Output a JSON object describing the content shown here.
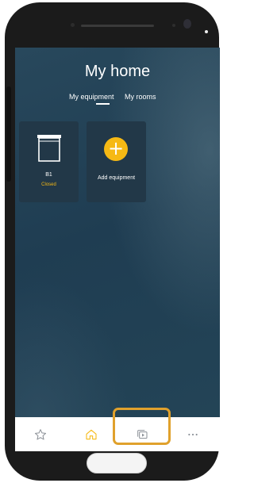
{
  "header": {
    "title": "My home"
  },
  "tabs": [
    {
      "label": "My equipment",
      "active": true
    },
    {
      "label": "My rooms",
      "active": false
    }
  ],
  "equipment": [
    {
      "name": "B1",
      "status": "Closed",
      "icon": "roller-shutter-icon"
    }
  ],
  "add_equipment": {
    "label": "Add equipment",
    "icon": "plus-icon"
  },
  "bottom_nav": [
    {
      "icon": "star-icon"
    },
    {
      "icon": "home-icon",
      "active": true
    },
    {
      "icon": "scenario-play-icon",
      "highlighted": true
    },
    {
      "icon": "more-icon"
    }
  ],
  "colors": {
    "accent": "#f6b914",
    "background": "#1f3d52",
    "card": "#223848",
    "highlight_border": "#e0a12c",
    "nav_icon": "#8a8f96"
  }
}
